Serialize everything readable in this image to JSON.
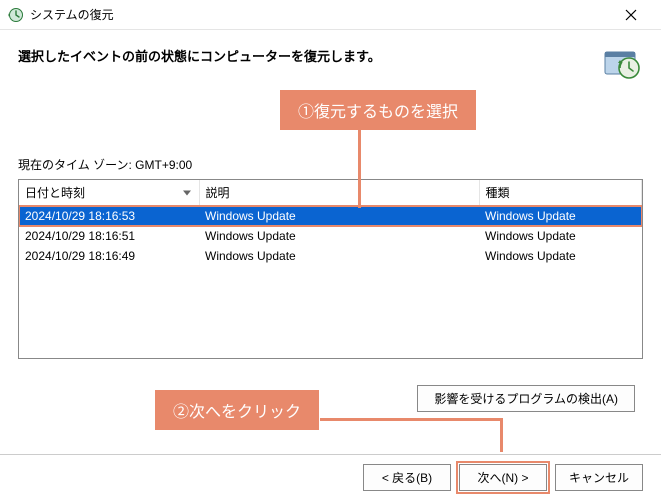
{
  "window": {
    "title": "システムの復元",
    "heading": "選択したイベントの前の状態にコンピューターを復元します。",
    "timezone_label": "現在のタイム ゾーン: GMT+9:00"
  },
  "table": {
    "columns": {
      "datetime": "日付と時刻",
      "description": "説明",
      "type": "種類"
    },
    "rows": [
      {
        "datetime": "2024/10/29 18:16:53",
        "description": "Windows Update",
        "type": "Windows Update",
        "selected": true
      },
      {
        "datetime": "2024/10/29 18:16:51",
        "description": "Windows Update",
        "type": "Windows Update",
        "selected": false
      },
      {
        "datetime": "2024/10/29 18:16:49",
        "description": "Windows Update",
        "type": "Windows Update",
        "selected": false
      }
    ]
  },
  "buttons": {
    "affected": "影響を受けるプログラムの検出(A)",
    "back": "< 戻る(B)",
    "next": "次へ(N) >",
    "cancel": "キャンセル"
  },
  "annotations": {
    "callout1": "①復元するものを選択",
    "callout2": "②次へをクリック"
  },
  "colors": {
    "accent": "#e8896b",
    "selection": "#0a64d1"
  }
}
